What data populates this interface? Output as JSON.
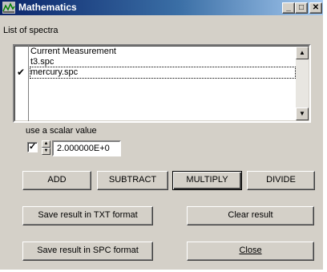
{
  "window": {
    "title": "Mathematics"
  },
  "caption_buttons": {
    "minimize": "_",
    "maximize": "□",
    "close": "✕"
  },
  "labels": {
    "list_of_spectra": "List of spectra",
    "scalar": "use a scalar value"
  },
  "spectra": [
    {
      "name": "Current Measurement",
      "checked": false,
      "selected": false
    },
    {
      "name": "t3.spc",
      "checked": false,
      "selected": false
    },
    {
      "name": "mercury.spc",
      "checked": true,
      "selected": true
    }
  ],
  "checkmark": "✔",
  "scalar": {
    "checked": true,
    "check_glyph": "✓",
    "value": "2.000000E+0"
  },
  "operations": {
    "add": "ADD",
    "subtract": "SUBTRACT",
    "multiply": "MULTIPLY",
    "divide": "DIVIDE"
  },
  "actions": {
    "save_txt": "Save result in TXT format",
    "clear": "Clear result",
    "save_spc": "Save result in SPC format",
    "close": "Close"
  },
  "icons": {
    "scroll_up": "▲",
    "scroll_down": "▼",
    "spin_up": "▲",
    "spin_down": "▼"
  }
}
